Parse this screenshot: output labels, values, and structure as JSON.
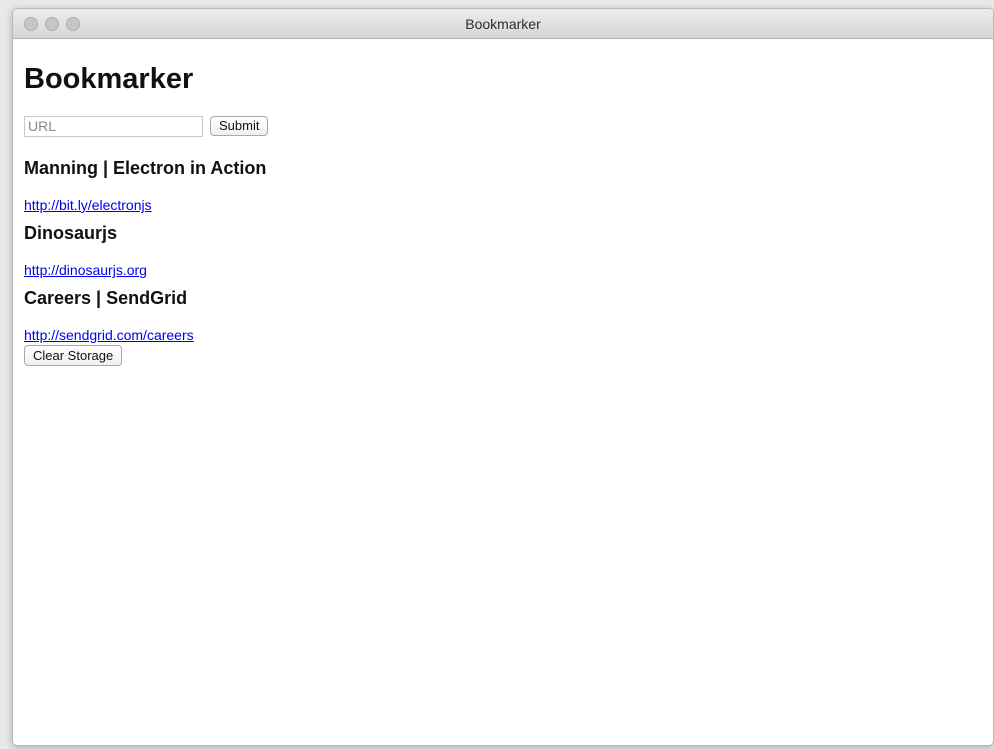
{
  "window": {
    "title": "Bookmarker"
  },
  "app": {
    "heading": "Bookmarker"
  },
  "form": {
    "url_placeholder": "URL",
    "url_value": "",
    "submit_label": "Submit"
  },
  "bookmarks": [
    {
      "title": "Manning | Electron in Action",
      "url": "http://bit.ly/electronjs"
    },
    {
      "title": "Dinosaurjs",
      "url": "http://dinosaurjs.org"
    },
    {
      "title": "Careers | SendGrid",
      "url": "http://sendgrid.com/careers"
    }
  ],
  "actions": {
    "clear_label": "Clear Storage"
  },
  "colors": {
    "link": "#0000ee",
    "traffic_light_inactive": "#c6c6c6"
  }
}
